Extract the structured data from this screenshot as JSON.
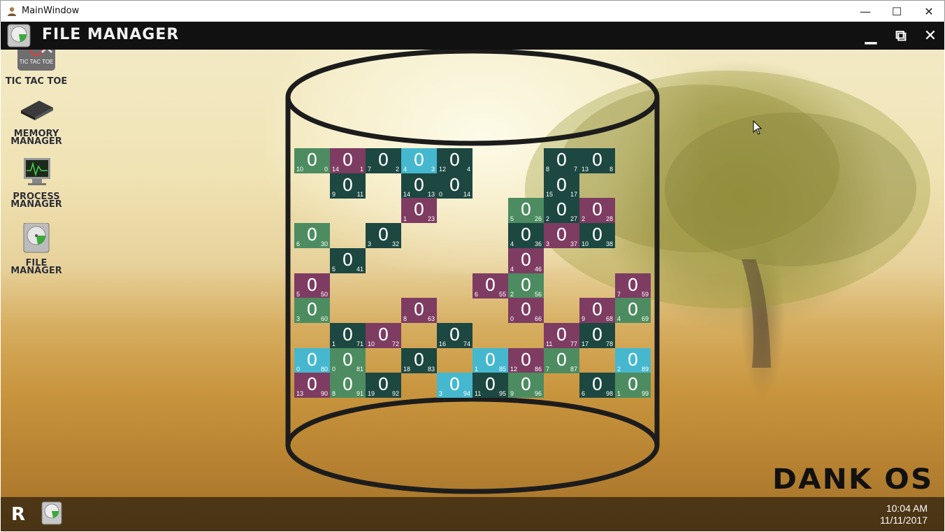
{
  "window": {
    "title": "MainWindow",
    "min": "—",
    "max": "☐",
    "close": "✕"
  },
  "app": {
    "title": "FILE MANAGER",
    "min": "▁",
    "max": "⧉",
    "close": "✕"
  },
  "desktop_icons": [
    {
      "label": "TIC TAC TOE",
      "icon": "tic-tac-toe-icon",
      "badge": "TIC TAC TOE"
    },
    {
      "label": "MEMORY MANAGER",
      "icon": "memory-chip-icon"
    },
    {
      "label": "PROCESS MANAGER",
      "icon": "process-monitor-icon"
    },
    {
      "label": "FILE MANAGER",
      "icon": "hard-drive-icon"
    }
  ],
  "grid": {
    "cells": [
      {
        "r": 0,
        "c": 0,
        "val": "0",
        "a": "10",
        "b": "0",
        "color": "green"
      },
      {
        "r": 0,
        "c": 1,
        "val": "0",
        "a": "14",
        "b": "1",
        "color": "plum"
      },
      {
        "r": 0,
        "c": 2,
        "val": "0",
        "a": "7",
        "b": "2",
        "color": "teal"
      },
      {
        "r": 0,
        "c": 3,
        "val": "0",
        "a": "4",
        "b": "3",
        "color": "cyan"
      },
      {
        "r": 0,
        "c": 4,
        "val": "0",
        "a": "12",
        "b": "4",
        "color": "teal"
      },
      {
        "r": 0,
        "c": 7,
        "val": "0",
        "a": "8",
        "b": "7",
        "color": "teal"
      },
      {
        "r": 0,
        "c": 8,
        "val": "0",
        "a": "13",
        "b": "8",
        "color": "teal"
      },
      {
        "r": 1,
        "c": 1,
        "val": "0",
        "a": "9",
        "b": "11",
        "color": "teal"
      },
      {
        "r": 1,
        "c": 3,
        "val": "0",
        "a": "14",
        "b": "13",
        "color": "teal"
      },
      {
        "r": 1,
        "c": 4,
        "val": "0",
        "a": "0",
        "b": "14",
        "color": "teal"
      },
      {
        "r": 1,
        "c": 7,
        "val": "0",
        "a": "15",
        "b": "17",
        "color": "teal"
      },
      {
        "r": 2,
        "c": 3,
        "val": "0",
        "a": "1",
        "b": "23",
        "color": "plum"
      },
      {
        "r": 2,
        "c": 6,
        "val": "0",
        "a": "5",
        "b": "26",
        "color": "green"
      },
      {
        "r": 2,
        "c": 7,
        "val": "0",
        "a": "2",
        "b": "27",
        "color": "teal"
      },
      {
        "r": 2,
        "c": 8,
        "val": "0",
        "a": "2",
        "b": "28",
        "color": "plum"
      },
      {
        "r": 3,
        "c": 0,
        "val": "0",
        "a": "6",
        "b": "30",
        "color": "green"
      },
      {
        "r": 3,
        "c": 2,
        "val": "0",
        "a": "3",
        "b": "32",
        "color": "teal"
      },
      {
        "r": 3,
        "c": 6,
        "val": "0",
        "a": "4",
        "b": "36",
        "color": "teal"
      },
      {
        "r": 3,
        "c": 7,
        "val": "0",
        "a": "3",
        "b": "37",
        "color": "plum"
      },
      {
        "r": 3,
        "c": 8,
        "val": "0",
        "a": "10",
        "b": "38",
        "color": "teal"
      },
      {
        "r": 4,
        "c": 1,
        "val": "0",
        "a": "5",
        "b": "41",
        "color": "teal"
      },
      {
        "r": 4,
        "c": 6,
        "val": "0",
        "a": "4",
        "b": "46",
        "color": "plum"
      },
      {
        "r": 5,
        "c": 0,
        "val": "0",
        "a": "5",
        "b": "50",
        "color": "plum"
      },
      {
        "r": 5,
        "c": 5,
        "val": "0",
        "a": "6",
        "b": "55",
        "color": "plum"
      },
      {
        "r": 5,
        "c": 6,
        "val": "0",
        "a": "2",
        "b": "56",
        "color": "green"
      },
      {
        "r": 5,
        "c": 9,
        "val": "0",
        "a": "7",
        "b": "59",
        "color": "plum"
      },
      {
        "r": 6,
        "c": 0,
        "val": "0",
        "a": "3",
        "b": "60",
        "color": "green"
      },
      {
        "r": 6,
        "c": 3,
        "val": "0",
        "a": "8",
        "b": "63",
        "color": "plum"
      },
      {
        "r": 6,
        "c": 6,
        "val": "0",
        "a": "0",
        "b": "66",
        "color": "plum"
      },
      {
        "r": 6,
        "c": 8,
        "val": "0",
        "a": "9",
        "b": "68",
        "color": "plum"
      },
      {
        "r": 6,
        "c": 9,
        "val": "0",
        "a": "4",
        "b": "69",
        "color": "green"
      },
      {
        "r": 7,
        "c": 1,
        "val": "0",
        "a": "1",
        "b": "71",
        "color": "teal"
      },
      {
        "r": 7,
        "c": 2,
        "val": "0",
        "a": "10",
        "b": "72",
        "color": "plum"
      },
      {
        "r": 7,
        "c": 4,
        "val": "0",
        "a": "16",
        "b": "74",
        "color": "teal"
      },
      {
        "r": 7,
        "c": 7,
        "val": "0",
        "a": "11",
        "b": "77",
        "color": "plum"
      },
      {
        "r": 7,
        "c": 8,
        "val": "0",
        "a": "17",
        "b": "78",
        "color": "teal"
      },
      {
        "r": 8,
        "c": 0,
        "val": "0",
        "a": "0",
        "b": "80",
        "color": "cyan"
      },
      {
        "r": 8,
        "c": 1,
        "val": "0",
        "a": "0",
        "b": "81",
        "color": "green"
      },
      {
        "r": 8,
        "c": 3,
        "val": "0",
        "a": "18",
        "b": "83",
        "color": "teal"
      },
      {
        "r": 8,
        "c": 5,
        "val": "0",
        "a": "1",
        "b": "85",
        "color": "cyan"
      },
      {
        "r": 8,
        "c": 6,
        "val": "0",
        "a": "12",
        "b": "86",
        "color": "plum"
      },
      {
        "r": 8,
        "c": 7,
        "val": "0",
        "a": "7",
        "b": "87",
        "color": "green"
      },
      {
        "r": 8,
        "c": 9,
        "val": "0",
        "a": "2",
        "b": "89",
        "color": "cyan"
      },
      {
        "r": 9,
        "c": 0,
        "val": "0",
        "a": "13",
        "b": "90",
        "color": "plum"
      },
      {
        "r": 9,
        "c": 1,
        "val": "0",
        "a": "8",
        "b": "91",
        "color": "green"
      },
      {
        "r": 9,
        "c": 2,
        "val": "0",
        "a": "19",
        "b": "92",
        "color": "teal"
      },
      {
        "r": 9,
        "c": 4,
        "val": "0",
        "a": "3",
        "b": "94",
        "color": "cyan"
      },
      {
        "r": 9,
        "c": 5,
        "val": "0",
        "a": "11",
        "b": "95",
        "color": "teal"
      },
      {
        "r": 9,
        "c": 6,
        "val": "0",
        "a": "9",
        "b": "96",
        "color": "green"
      },
      {
        "r": 9,
        "c": 8,
        "val": "0",
        "a": "6",
        "b": "98",
        "color": "teal"
      },
      {
        "r": 9,
        "c": 9,
        "val": "0",
        "a": "1",
        "b": "99",
        "color": "green"
      }
    ]
  },
  "brand": "DANK OS",
  "taskbar": {
    "start_label": "R",
    "time": "10:04 AM",
    "date": "11/11/2017"
  }
}
